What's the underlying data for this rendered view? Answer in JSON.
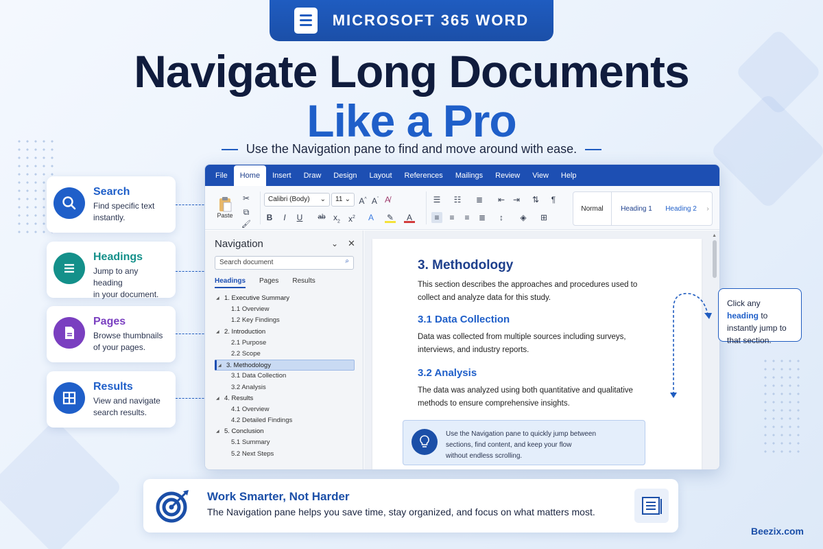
{
  "header": {
    "badge": "MICROSOFT 365 WORD",
    "title_line1": "Navigate Long Documents",
    "title_line2": "Like a Pro",
    "subtitle": "Use the Navigation pane to find and move around with ease."
  },
  "features": [
    {
      "title": "Search",
      "desc_line1": "Find specific text",
      "desc_line2": "instantly.",
      "color": "#1f5fc9",
      "icon": "search-icon"
    },
    {
      "title": "Headings",
      "desc_line1": "Jump to any heading",
      "desc_line2": "in your document.",
      "color": "#14908a",
      "icon": "list-icon"
    },
    {
      "title": "Pages",
      "desc_line1": "Browse thumbnails",
      "desc_line2": "of your pages.",
      "color": "#7a3fc0",
      "icon": "page-icon"
    },
    {
      "title": "Results",
      "desc_line1": "View and navigate",
      "desc_line2": "search results.",
      "color": "#1f5fc9",
      "icon": "grid-icon"
    }
  ],
  "menu": [
    "File",
    "Home",
    "Insert",
    "Draw",
    "Design",
    "Layout",
    "References",
    "Mailings",
    "Review",
    "View",
    "Help"
  ],
  "ribbon": {
    "paste": "Paste",
    "font": "Calibri (Body)",
    "size": "11",
    "styles": [
      "Normal",
      "Heading 1",
      "Heading 2"
    ]
  },
  "nav": {
    "title": "Navigation",
    "search_placeholder": "Search document",
    "tabs": [
      "Headings",
      "Pages",
      "Results"
    ],
    "tree": [
      {
        "label": "1.  Executive Summary",
        "level": 1
      },
      {
        "label": "1.1  Overview",
        "level": 2
      },
      {
        "label": "1.2  Key Findings",
        "level": 2
      },
      {
        "label": "2.  Introduction",
        "level": 1
      },
      {
        "label": "2.1  Purpose",
        "level": 2
      },
      {
        "label": "2.2  Scope",
        "level": 2
      },
      {
        "label": "3. Methodology",
        "level": 1,
        "selected": true
      },
      {
        "label": "3.1  Data Collection",
        "level": 2
      },
      {
        "label": "3.2  Analysis",
        "level": 2
      },
      {
        "label": "4.  Results",
        "level": 1
      },
      {
        "label": "4.1  Overview",
        "level": 2
      },
      {
        "label": "4.2  Detailed Findings",
        "level": 2
      },
      {
        "label": "5.  Conclusion",
        "level": 1
      },
      {
        "label": "5.1  Summary",
        "level": 2
      },
      {
        "label": "5.2  Next Steps",
        "level": 2
      }
    ]
  },
  "document": {
    "h1": "3. Methodology",
    "p1": "This section describes the approaches and procedures used to collect and analyze data for this study.",
    "h2a": "3.1  Data Collection",
    "p2": "Data was collected from multiple sources including surveys, interviews, and industry reports.",
    "h2b": "3.2  Analysis",
    "p3": "The data was analyzed using both quantitative and qualitative methods to ensure comprehensive insights.",
    "tip_line1": "Use the Navigation pane to quickly jump between",
    "tip_line2": "sections, find content, and keep your flow",
    "tip_line3": "without endless scrolling."
  },
  "callout": {
    "pre": "Click any ",
    "highlight": "heading",
    "post": " to instantly jump to that section."
  },
  "bottom": {
    "title": "Work Smarter, Not Harder",
    "desc": "The Navigation pane helps you save time, stay organized, and focus on what matters most."
  },
  "brand": "Beezix.com",
  "colors": {
    "primary": "#1d4fb3",
    "title_dark": "#101c3d",
    "title_blue": "#1f5fc9"
  }
}
